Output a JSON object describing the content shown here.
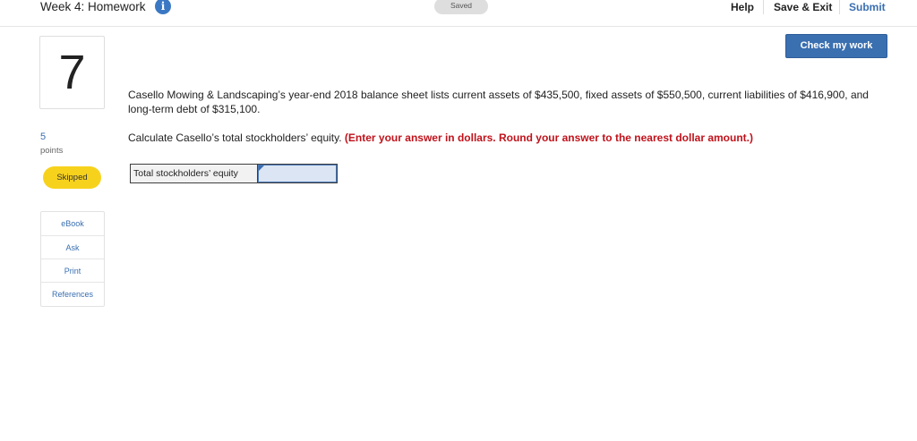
{
  "header": {
    "assignment_title": "Week 4: Homework",
    "info_icon": "info-icon",
    "saved_status": "Saved",
    "help_label": "Help",
    "save_exit_label": "Save & Exit",
    "submit_label": "Submit"
  },
  "question": {
    "number": "7",
    "points": "5",
    "points_label": "points",
    "status": "Skipped",
    "check_label": "Check my work",
    "body": "Casello Mowing & Landscaping’s year-end 2018 balance sheet lists current assets of $435,500, fixed assets of $550,500, current liabilities of $416,900, and long-term debt of $315,100.",
    "prompt": "Calculate Casello’s total stockholders’ equity.",
    "instruction": "(Enter your answer in dollars. Round your answer to the nearest dollar amount.)",
    "answer_label": "Total stockholders’ equity",
    "answer_value": ""
  },
  "tools": {
    "ebook": "eBook",
    "ask": "Ask",
    "print": "Print",
    "references": "References"
  },
  "colors": {
    "accent": "#3a6fb0",
    "status_skipped": "#f7d21d",
    "instruction_red": "#c0121b",
    "input_fill": "#dbe5f3"
  }
}
